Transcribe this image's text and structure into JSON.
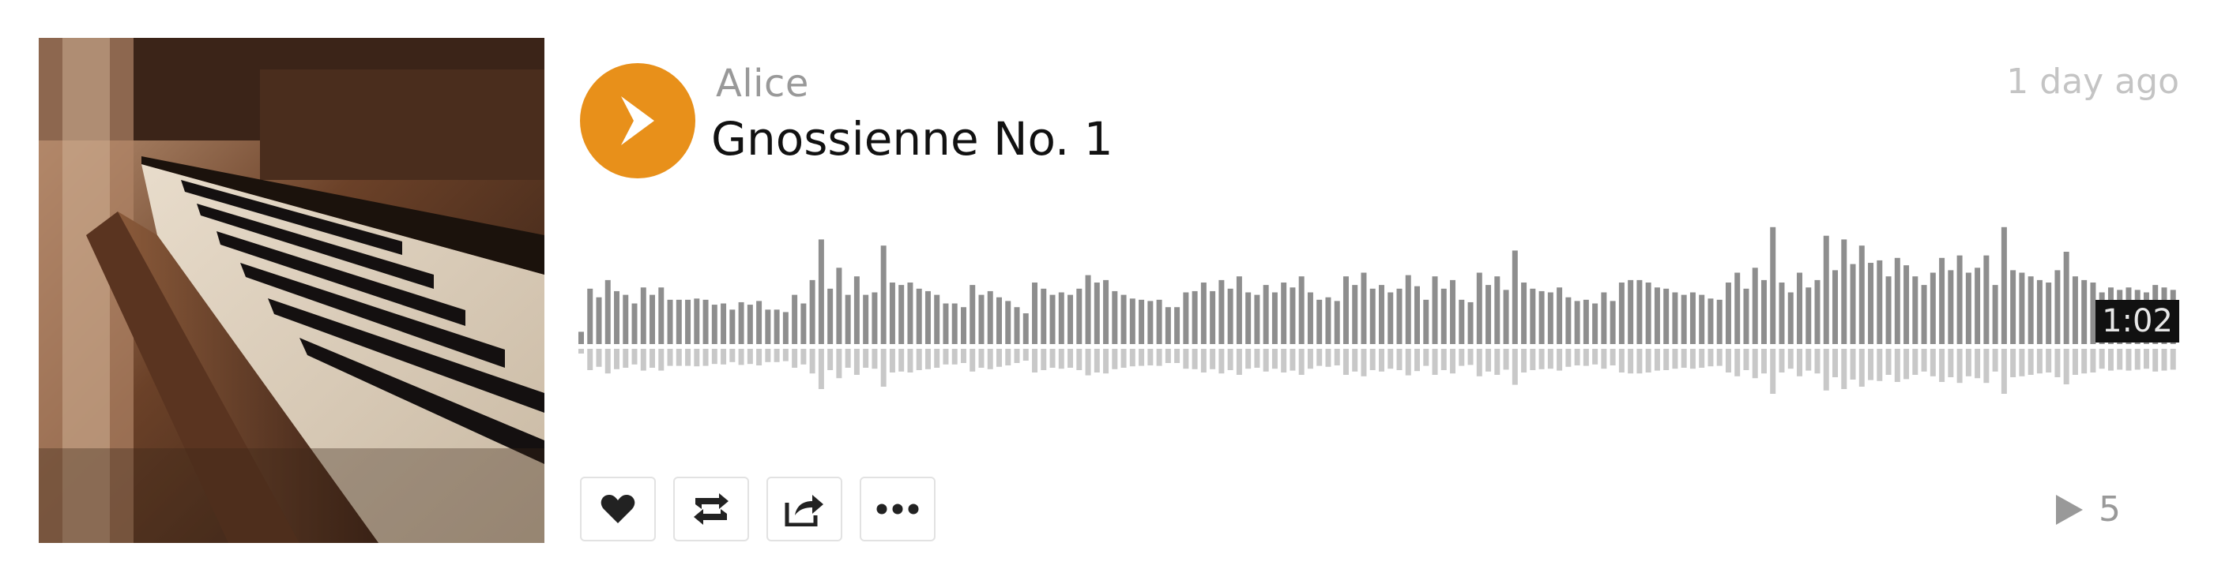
{
  "track": {
    "artist": "Alice",
    "title": "Gnossienne No. 1",
    "posted": "1 day ago",
    "current_time": "1:02",
    "play_count": "5",
    "progress": 0.94
  },
  "player": {
    "accent_color": "#e8901a",
    "play_icon": "play-icon"
  },
  "actions": [
    {
      "name": "like",
      "icon": "heart-icon"
    },
    {
      "name": "repost",
      "icon": "repost-icon"
    },
    {
      "name": "share",
      "icon": "share-icon"
    },
    {
      "name": "more",
      "icon": "more-icon"
    }
  ],
  "waveform": {
    "played_color": "#8e8e8e",
    "played_reflection_color": "#c8c8c8",
    "levels": [
      0.1,
      0.45,
      0.38,
      0.52,
      0.43,
      0.4,
      0.33,
      0.46,
      0.4,
      0.46,
      0.36,
      0.36,
      0.36,
      0.37,
      0.36,
      0.32,
      0.33,
      0.28,
      0.34,
      0.32,
      0.35,
      0.28,
      0.28,
      0.26,
      0.4,
      0.33,
      0.52,
      0.85,
      0.45,
      0.62,
      0.4,
      0.55,
      0.4,
      0.42,
      0.8,
      0.5,
      0.48,
      0.5,
      0.45,
      0.43,
      0.4,
      0.33,
      0.33,
      0.3,
      0.48,
      0.4,
      0.43,
      0.38,
      0.35,
      0.3,
      0.25,
      0.5,
      0.45,
      0.4,
      0.42,
      0.4,
      0.45,
      0.56,
      0.5,
      0.52,
      0.43,
      0.4,
      0.37,
      0.36,
      0.35,
      0.36,
      0.3,
      0.3,
      0.42,
      0.43,
      0.5,
      0.43,
      0.52,
      0.45,
      0.55,
      0.42,
      0.4,
      0.48,
      0.42,
      0.5,
      0.46,
      0.55,
      0.42,
      0.36,
      0.38,
      0.35,
      0.55,
      0.48,
      0.58,
      0.45,
      0.48,
      0.42,
      0.45,
      0.56,
      0.47,
      0.36,
      0.55,
      0.45,
      0.52,
      0.36,
      0.34,
      0.58,
      0.48,
      0.55,
      0.44,
      0.76,
      0.5,
      0.45,
      0.43,
      0.42,
      0.46,
      0.38,
      0.35,
      0.36,
      0.33,
      0.42,
      0.35,
      0.5,
      0.52,
      0.52,
      0.5,
      0.46,
      0.45,
      0.42,
      0.4,
      0.42,
      0.4,
      0.37,
      0.36,
      0.5,
      0.58,
      0.45,
      0.62,
      0.52,
      0.95,
      0.5,
      0.42,
      0.58,
      0.46,
      0.52,
      0.88,
      0.6,
      0.85,
      0.65,
      0.8,
      0.66,
      0.68,
      0.55,
      0.7,
      0.64,
      0.55,
      0.48,
      0.58,
      0.7,
      0.6,
      0.72,
      0.58,
      0.62,
      0.72,
      0.48,
      0.95,
      0.6,
      0.58,
      0.55,
      0.52,
      0.5,
      0.6,
      0.75,
      0.55,
      0.52,
      0.5,
      0.42,
      0.46,
      0.44,
      0.46,
      0.44,
      0.42,
      0.48,
      0.46,
      0.44
    ]
  }
}
